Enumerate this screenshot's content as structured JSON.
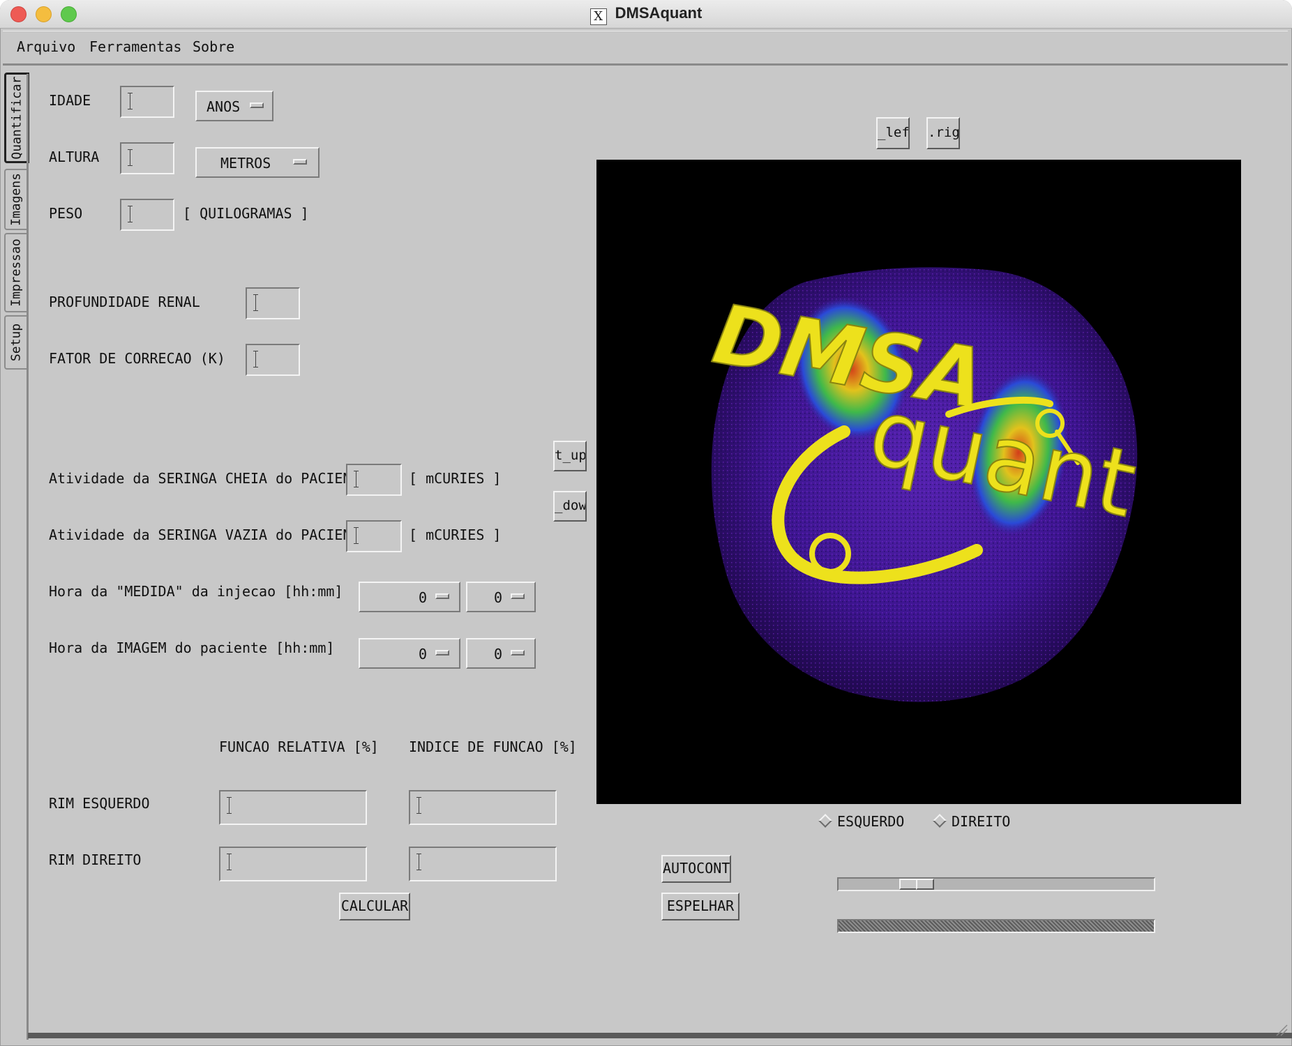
{
  "window": {
    "title": "DMSAquant",
    "x_icon": "X"
  },
  "menu": {
    "items": [
      "Arquivo",
      "Ferramentas",
      "Sobre"
    ]
  },
  "tabs": [
    "Quantificar",
    "Imagens",
    "Impressao",
    "Setup"
  ],
  "form": {
    "idade": {
      "label": "IDADE",
      "unit": "ANOS"
    },
    "altura": {
      "label": "ALTURA",
      "unit": "METROS"
    },
    "peso": {
      "label": "PESO",
      "unit": "[ QUILOGRAMAS ]"
    },
    "profundidade": {
      "label": "PROFUNDIDADE RENAL"
    },
    "fator": {
      "label": "FATOR DE CORRECAO (K)"
    },
    "seringa_cheia": {
      "label": "Atividade da SERINGA CHEIA do PACIENTE",
      "unit": "[ mCURIES ]"
    },
    "seringa_vazia": {
      "label": "Atividade da SERINGA VAZIA do PACIENTE",
      "unit": "[ mCURIES ]"
    },
    "hora_medida": {
      "label": "Hora da \"MEDIDA\" da injecao [hh:mm]",
      "hh": "0",
      "mm": "0"
    },
    "hora_imagem": {
      "label": "Hora da IMAGEM do paciente [hh:mm]",
      "hh": "0",
      "mm": "0"
    }
  },
  "results": {
    "col_relativa": "FUNCAO RELATIVA [%]",
    "col_indice": "INDICE DE FUNCAO [%]",
    "rim_esquerdo": "RIM ESQUERDO",
    "rim_direito": "RIM DIREITO",
    "calcular": "CALCULAR"
  },
  "image_controls": {
    "left_btn": "_lef",
    "right_btn": ".righ",
    "up_btn": "t_up",
    "down_btn": "_dow",
    "radio_esquerdo": "ESQUERDO",
    "radio_direito": "DIREITO",
    "autocont": "AUTOCONT",
    "espelhar": "ESPELHAR",
    "slider_value": 0.22
  },
  "logo": {
    "line1": "DMSA",
    "line2": "quant"
  },
  "colors": {
    "window_bg": "#c8c8c8",
    "image_bg": "#000000",
    "logo_yellow": "#e8e21a",
    "kidney_purple": "#4b1a8f"
  }
}
